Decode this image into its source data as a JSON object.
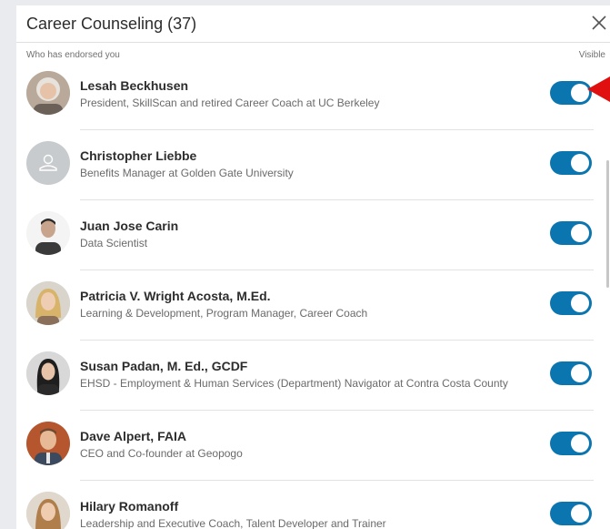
{
  "modal": {
    "title": "Career Counseling (37)",
    "close_glyph": "✕"
  },
  "subheader": {
    "left": "Who has endorsed you",
    "right": "Visible"
  },
  "endorsers": [
    {
      "name": "Lesah Beckhusen",
      "headline": "President, SkillScan and retired Career Coach at UC Berkeley",
      "visible": true,
      "avatar": "photo"
    },
    {
      "name": "Christopher Liebbe",
      "headline": "Benefits Manager at Golden Gate University",
      "visible": true,
      "avatar": "placeholder"
    },
    {
      "name": "Juan Jose Carin",
      "headline": "Data Scientist",
      "visible": true,
      "avatar": "photo"
    },
    {
      "name": "Patricia V. Wright Acosta, M.Ed.",
      "headline": "Learning & Development, Program Manager, Career Coach",
      "visible": true,
      "avatar": "photo"
    },
    {
      "name": "Susan Padan, M. Ed., GCDF",
      "headline": "EHSD - Employment & Human Services (Department) Navigator at Contra Costa County",
      "visible": true,
      "avatar": "photo"
    },
    {
      "name": "Dave Alpert, FAIA",
      "headline": "CEO and Co-founder at Geopogo",
      "visible": true,
      "avatar": "photo"
    },
    {
      "name": "Hilary Romanoff",
      "headline": "Leadership and Executive Coach, Talent Developer and Trainer",
      "visible": true,
      "avatar": "photo"
    }
  ],
  "colors": {
    "toggle_on": "#0b75b0",
    "annotation_arrow": "#e01010"
  }
}
